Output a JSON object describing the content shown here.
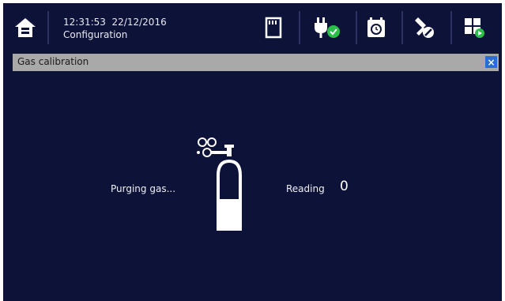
{
  "status": {
    "time": "12:31:53",
    "date": "22/12/2016",
    "screen": "Configuration"
  },
  "toolbar": {
    "icons": [
      "home-icon",
      "sd-card-icon",
      "power-ok-icon",
      "alarm-clock-icon",
      "tools-icon",
      "windows-icon"
    ]
  },
  "dialog": {
    "title": "Gas calibration",
    "close_label": "×",
    "status_label": "Purging gas...",
    "reading_label": "Reading",
    "reading_value": "0"
  },
  "colors": {
    "background": "#0d1238",
    "titlebar": "#a9a9a9",
    "close": "#2d6bd6",
    "ok_green": "#2bbf4a"
  }
}
